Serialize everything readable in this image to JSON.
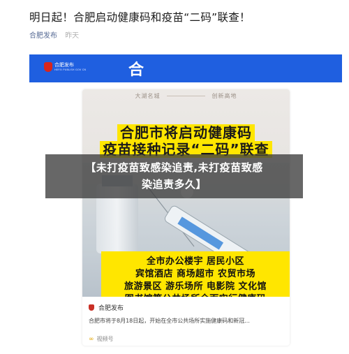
{
  "article": {
    "title": "明日起！合肥启动健康码和疫苗“二码”联查！",
    "author": "合肥发布",
    "time": "昨天"
  },
  "banner": {
    "logo_text": "合肥发布",
    "logo_sub": "HEFEI PUBLISH GOV CN",
    "big_char": "合",
    "bg_color": "#1f5fe0"
  },
  "poster": {
    "top_left": "大湖名城",
    "top_right": "创新高地",
    "headline_1": "合肥市将启动健康码",
    "headline_2": "疫苗接种记录“二码”联查",
    "places": [
      "全市办公楼宇 居民小区",
      "宾馆酒店 商场超市 农贸市场",
      "旅游景区 游乐场所 电影院 文化馆",
      "图书馆等公共场所全面实行健康码"
    ],
    "accent_color": "#ffe600"
  },
  "card": {
    "source_name": "合肥发布",
    "description": "合肥市将于8月18日起，开始在全市公共场所实施健康码和新冠...",
    "footer_label": "视频号"
  },
  "overlay": {
    "line_1": "【未打疫苗致感染追责,未打疫苗致感",
    "line_2": "染追责多久】"
  }
}
